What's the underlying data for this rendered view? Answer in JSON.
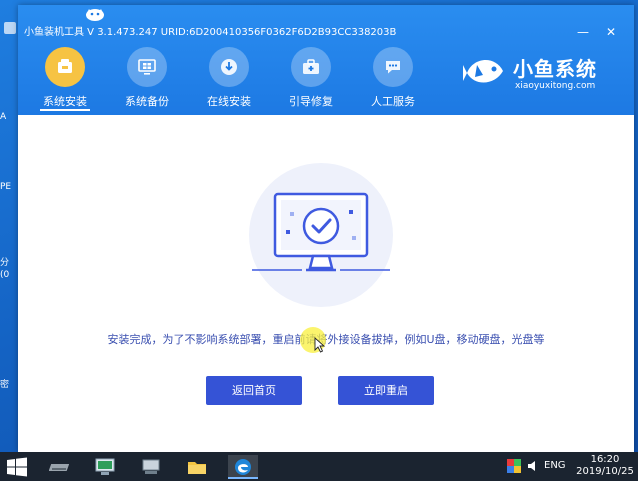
{
  "desktop": {
    "icons": [
      {
        "label": "A"
      },
      {
        "label": "PE"
      },
      {
        "label": "分"
      },
      {
        "label": "(0"
      },
      {
        "label": "密"
      }
    ]
  },
  "window": {
    "title": "小鱼装机工具 V 3.1.473.247 URID:6D200410356F0362F6D2B93CC338203B",
    "controls": {
      "minimize": "—",
      "close": "✕"
    }
  },
  "nav": {
    "items": [
      {
        "label": "系统安装",
        "icon": "install-icon",
        "active": true
      },
      {
        "label": "系统备份",
        "icon": "windows-backup-icon",
        "active": false
      },
      {
        "label": "在线安装",
        "icon": "download-icon",
        "active": false
      },
      {
        "label": "引导修复",
        "icon": "toolbox-icon",
        "active": false
      },
      {
        "label": "人工服务",
        "icon": "chat-icon",
        "active": false
      }
    ]
  },
  "brand": {
    "title": "小鱼系统",
    "subtitle": "xiaoyuxitong.com"
  },
  "main": {
    "message": "安装完成，为了不影响系统部署，重启前请将外接设备拔掉，例如U盘，移动硬盘，光盘等",
    "buttons": {
      "back": "返回首页",
      "restart": "立即重启"
    }
  },
  "taskbar": {
    "apps": [
      "storage-icon",
      "computer-icon",
      "network-icon",
      "folder-icon",
      "edge-icon"
    ],
    "tray": {
      "language": "ENG",
      "time": "16:20",
      "date": "2019/10/25"
    }
  },
  "colors": {
    "header": "#1d79e3",
    "active_nav": "#f6c343",
    "button": "#3553d6",
    "message": "#3a4fb0"
  }
}
